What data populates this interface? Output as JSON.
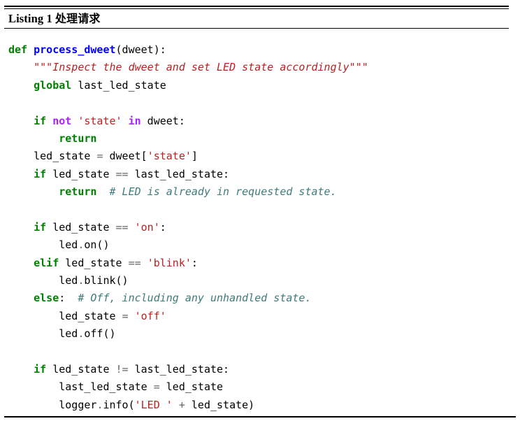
{
  "figure": {
    "caption_label": "Listing 1",
    "caption_title": "处理请求",
    "language": "python"
  },
  "colors": {
    "keyword": "#008000",
    "operator_keyword": "#AA22FF",
    "function_name": "#0000FF",
    "string": "#BA2121",
    "docstring": "#BA2121",
    "comment": "#3D7B7B",
    "operator": "#666666",
    "text": "#000000",
    "background": "#FFFFFF",
    "rule": "#000000"
  },
  "code": {
    "lines": [
      {
        "n": 1,
        "text": "def process_dweet(dweet):",
        "tokens": [
          {
            "t": "def",
            "c": "kw"
          },
          {
            "t": " ",
            "c": "plain"
          },
          {
            "t": "process_dweet",
            "c": "fn"
          },
          {
            "t": "(dweet):",
            "c": "plain"
          }
        ]
      },
      {
        "n": 2,
        "text": "    \"\"\"Inspect the dweet and set LED state accordingly\"\"\"",
        "tokens": [
          {
            "t": "    ",
            "c": "plain"
          },
          {
            "t": "\"\"\"Inspect the dweet and set LED state accordingly\"\"\"",
            "c": "doc"
          }
        ]
      },
      {
        "n": 3,
        "text": "    global last_led_state",
        "tokens": [
          {
            "t": "    ",
            "c": "plain"
          },
          {
            "t": "global",
            "c": "kw"
          },
          {
            "t": " last_led_state",
            "c": "plain"
          }
        ]
      },
      {
        "n": 4,
        "text": "",
        "tokens": []
      },
      {
        "n": 5,
        "text": "    if not 'state' in dweet:",
        "tokens": [
          {
            "t": "    ",
            "c": "plain"
          },
          {
            "t": "if",
            "c": "kw"
          },
          {
            "t": " ",
            "c": "plain"
          },
          {
            "t": "not",
            "c": "opkw"
          },
          {
            "t": " ",
            "c": "plain"
          },
          {
            "t": "'state'",
            "c": "str"
          },
          {
            "t": " ",
            "c": "plain"
          },
          {
            "t": "in",
            "c": "opkw"
          },
          {
            "t": " dweet:",
            "c": "plain"
          }
        ]
      },
      {
        "n": 6,
        "text": "        return",
        "tokens": [
          {
            "t": "        ",
            "c": "plain"
          },
          {
            "t": "return",
            "c": "kw"
          }
        ]
      },
      {
        "n": 7,
        "text": "    led_state = dweet['state']",
        "tokens": [
          {
            "t": "    led_state ",
            "c": "plain"
          },
          {
            "t": "=",
            "c": "op"
          },
          {
            "t": " dweet[",
            "c": "plain"
          },
          {
            "t": "'state'",
            "c": "str"
          },
          {
            "t": "]",
            "c": "plain"
          }
        ]
      },
      {
        "n": 8,
        "text": "    if led_state == last_led_state:",
        "tokens": [
          {
            "t": "    ",
            "c": "plain"
          },
          {
            "t": "if",
            "c": "kw"
          },
          {
            "t": " led_state ",
            "c": "plain"
          },
          {
            "t": "==",
            "c": "op"
          },
          {
            "t": " last_led_state:",
            "c": "plain"
          }
        ]
      },
      {
        "n": 9,
        "text": "        return  # LED is already in requested state.",
        "tokens": [
          {
            "t": "        ",
            "c": "plain"
          },
          {
            "t": "return",
            "c": "kw"
          },
          {
            "t": "  ",
            "c": "plain"
          },
          {
            "t": "# LED is already in requested state.",
            "c": "cmt"
          }
        ]
      },
      {
        "n": 10,
        "text": "",
        "tokens": []
      },
      {
        "n": 11,
        "text": "    if led_state == 'on':",
        "tokens": [
          {
            "t": "    ",
            "c": "plain"
          },
          {
            "t": "if",
            "c": "kw"
          },
          {
            "t": " led_state ",
            "c": "plain"
          },
          {
            "t": "==",
            "c": "op"
          },
          {
            "t": " ",
            "c": "plain"
          },
          {
            "t": "'on'",
            "c": "str"
          },
          {
            "t": ":",
            "c": "plain"
          }
        ]
      },
      {
        "n": 12,
        "text": "        led.on()",
        "tokens": [
          {
            "t": "        led",
            "c": "plain"
          },
          {
            "t": ".",
            "c": "op"
          },
          {
            "t": "on()",
            "c": "plain"
          }
        ]
      },
      {
        "n": 13,
        "text": "    elif led_state == 'blink':",
        "tokens": [
          {
            "t": "    ",
            "c": "plain"
          },
          {
            "t": "elif",
            "c": "kw"
          },
          {
            "t": " led_state ",
            "c": "plain"
          },
          {
            "t": "==",
            "c": "op"
          },
          {
            "t": " ",
            "c": "plain"
          },
          {
            "t": "'blink'",
            "c": "str"
          },
          {
            "t": ":",
            "c": "plain"
          }
        ]
      },
      {
        "n": 14,
        "text": "        led.blink()",
        "tokens": [
          {
            "t": "        led",
            "c": "plain"
          },
          {
            "t": ".",
            "c": "op"
          },
          {
            "t": "blink()",
            "c": "plain"
          }
        ]
      },
      {
        "n": 15,
        "text": "    else:  # Off, including any unhandled state.",
        "tokens": [
          {
            "t": "    ",
            "c": "plain"
          },
          {
            "t": "else",
            "c": "kw"
          },
          {
            "t": ":",
            "c": "plain"
          },
          {
            "t": "  ",
            "c": "plain"
          },
          {
            "t": "# Off, including any unhandled state.",
            "c": "cmt"
          }
        ]
      },
      {
        "n": 16,
        "text": "        led_state = 'off'",
        "tokens": [
          {
            "t": "        led_state ",
            "c": "plain"
          },
          {
            "t": "=",
            "c": "op"
          },
          {
            "t": " ",
            "c": "plain"
          },
          {
            "t": "'off'",
            "c": "str"
          }
        ]
      },
      {
        "n": 17,
        "text": "        led.off()",
        "tokens": [
          {
            "t": "        led",
            "c": "plain"
          },
          {
            "t": ".",
            "c": "op"
          },
          {
            "t": "off()",
            "c": "plain"
          }
        ]
      },
      {
        "n": 18,
        "text": "",
        "tokens": []
      },
      {
        "n": 19,
        "text": "    if led_state != last_led_state:",
        "tokens": [
          {
            "t": "    ",
            "c": "plain"
          },
          {
            "t": "if",
            "c": "kw"
          },
          {
            "t": " led_state ",
            "c": "plain"
          },
          {
            "t": "!=",
            "c": "op"
          },
          {
            "t": " last_led_state:",
            "c": "plain"
          }
        ]
      },
      {
        "n": 20,
        "text": "        last_led_state = led_state",
        "tokens": [
          {
            "t": "        last_led_state ",
            "c": "plain"
          },
          {
            "t": "=",
            "c": "op"
          },
          {
            "t": " led_state",
            "c": "plain"
          }
        ]
      },
      {
        "n": 21,
        "text": "        logger.info('LED ' + led_state)",
        "tokens": [
          {
            "t": "        logger",
            "c": "plain"
          },
          {
            "t": ".",
            "c": "op"
          },
          {
            "t": "info(",
            "c": "plain"
          },
          {
            "t": "'LED '",
            "c": "str"
          },
          {
            "t": " ",
            "c": "plain"
          },
          {
            "t": "+",
            "c": "op"
          },
          {
            "t": " led_state)",
            "c": "plain"
          }
        ]
      }
    ]
  }
}
